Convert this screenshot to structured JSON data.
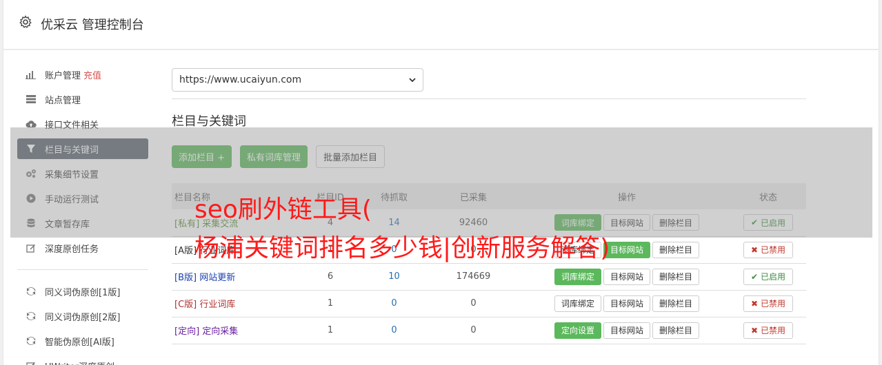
{
  "header": {
    "title": "优采云 管理控制台",
    "icon": "gear-icon"
  },
  "sidebar": {
    "items": [
      {
        "label": "账户管理",
        "tag": "充值",
        "icon": "bar-chart-icon"
      },
      {
        "label": "站点管理",
        "icon": "server-icon"
      },
      {
        "label": "接口文件相关",
        "icon": "cloud-upload-icon"
      },
      {
        "label": "栏目与关键词",
        "icon": "filter-icon",
        "active": true
      },
      {
        "label": "采集细节设置",
        "icon": "cogs-icon"
      },
      {
        "label": "手动运行测试",
        "icon": "play-circle-icon"
      },
      {
        "label": "文章暂存库",
        "icon": "database-icon"
      },
      {
        "label": "深度原创任务",
        "icon": "edit-icon"
      }
    ],
    "items2": [
      {
        "label": "同义词伪原创[1版]",
        "icon": "refresh-icon"
      },
      {
        "label": "同义词伪原创[2版]",
        "icon": "refresh-icon"
      },
      {
        "label": "智能伪原创[AI版]",
        "icon": "refresh-icon"
      },
      {
        "label": "UWriter深度原创",
        "icon": "edit-icon"
      }
    ]
  },
  "site_select": {
    "value": "https://www.ucaiyun.com"
  },
  "section": {
    "title": "栏目与关键词"
  },
  "buttons": {
    "add_column": "添加栏目 +",
    "private_lib": "私有词库管理",
    "batch_add": "批量添加栏目"
  },
  "table": {
    "headers": [
      "栏目名称",
      "栏目ID",
      "待抓取",
      "已采集",
      "操作",
      "状态"
    ],
    "rows": [
      {
        "prefix": "[私有]",
        "name": "采集交流",
        "id": "4",
        "pending": "14",
        "collected": "92460",
        "bind": "词库绑定",
        "target": "目标网站",
        "delete": "删除栏目",
        "status": "已启用"
      },
      {
        "prefix": "[A版]",
        "name": "行业词库",
        "id": "1",
        "pending": "0",
        "collected": "0",
        "bind": "词库绑定",
        "target": "目标网站",
        "delete": "删除栏目",
        "status": "已禁用"
      },
      {
        "prefix": "[B版]",
        "name": "网站更新",
        "id": "6",
        "pending": "10",
        "collected": "174669",
        "bind": "词库绑定",
        "target": "目标网站",
        "delete": "删除栏目",
        "status": "已启用"
      },
      {
        "prefix": "[C版]",
        "name": "行业词库",
        "id": "1",
        "pending": "0",
        "collected": "0",
        "bind": "词库绑定",
        "target": "目标网站",
        "delete": "删除栏目",
        "status": "已禁用"
      },
      {
        "prefix": "[定向]",
        "name": "定向采集",
        "id": "1",
        "pending": "0",
        "collected": "0",
        "bind": "定向设置",
        "target": "目标网站",
        "delete": "删除栏目",
        "status": "已禁用"
      }
    ]
  },
  "overlay": {
    "line1": "seo刷外链工具(",
    "line2": "杨浦关键词排名多少钱|创新服务解答)"
  },
  "colors": {
    "accent_green": "#5cb85c",
    "active_nav": "#5a6470",
    "overlay_text": "#ff1a1a"
  }
}
